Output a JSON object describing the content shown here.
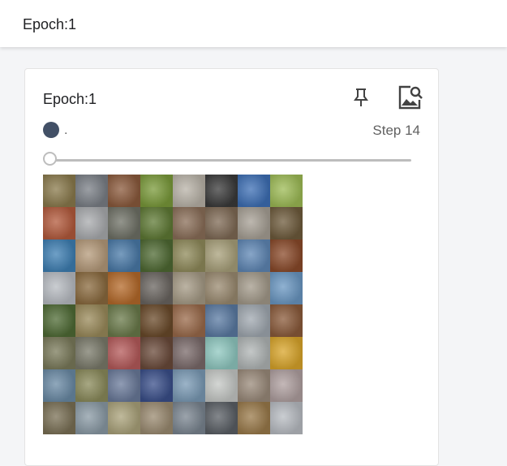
{
  "header": {
    "title": "Epoch:1"
  },
  "card": {
    "title": "Epoch:1",
    "run_name": ".",
    "step_label": "Step 14",
    "run_color": "#425066",
    "slider_value": 0,
    "icons": [
      "pin-icon",
      "fullscreen-image-icon"
    ]
  },
  "image_grid": {
    "rows": 8,
    "cols": 8,
    "tiles": [
      [
        "#8a7a4c",
        "#7a7f86",
        "#8b5a3c",
        "#7a9a3a",
        "#b9b3a8",
        "#3a3a3a",
        "#3d6fb5",
        "#9dbb55"
      ],
      [
        "#b35a3c",
        "#a9abae",
        "#6f7166",
        "#5f7a35",
        "#8a6e58",
        "#7f6a55",
        "#a7a095",
        "#6e5b3c"
      ],
      [
        "#3e7fb3",
        "#b59a7a",
        "#4a7aa8",
        "#4f6a33",
        "#8f8a5a",
        "#a8a07a",
        "#5f87b5",
        "#8a4a2a"
      ],
      [
        "#b8bcc2",
        "#8a6a3e",
        "#b56a2a",
        "#6a6560",
        "#a59a85",
        "#9a8a70",
        "#a39a8a",
        "#6a97c2"
      ],
      [
        "#4f6b35",
        "#9a8a5a",
        "#6a7a4a",
        "#6a4a2a",
        "#9a6a4a",
        "#5a7aa2",
        "#a0a8b0",
        "#8a5a3a"
      ],
      [
        "#7a7a5a",
        "#7a7a6a",
        "#b55a5a",
        "#6a4a3a",
        "#7a6a6a",
        "#8fc8c0",
        "#b0b5b5",
        "#d9a52a"
      ],
      [
        "#6a8aa5",
        "#8a8a5a",
        "#6a7a9a",
        "#3a4f8a",
        "#7a9ab5",
        "#c5c8c5",
        "#9a8a7a",
        "#b0a0a0"
      ],
      [
        "#7a7055",
        "#8a9aa5",
        "#aaa27a",
        "#9a8a70",
        "#7a8590",
        "#5a5f65",
        "#9a7a4a",
        "#b8bcc2"
      ]
    ]
  }
}
